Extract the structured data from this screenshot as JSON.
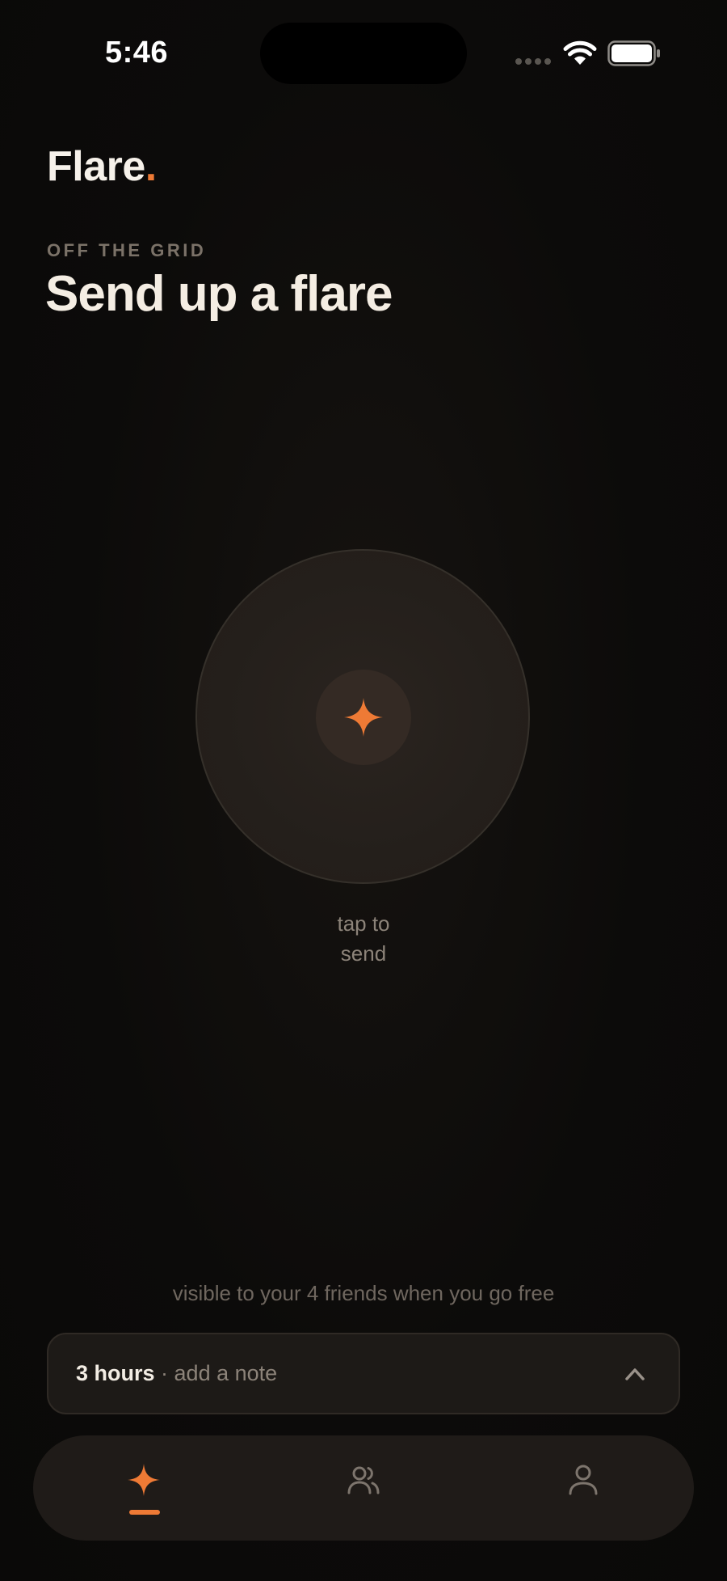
{
  "status_bar": {
    "time": "5:46"
  },
  "header": {
    "brand": "Flare",
    "brand_dot": ".",
    "eyebrow": "OFF THE GRID",
    "title": "Send up a flare"
  },
  "flare_button": {
    "icon": "sparkle-icon",
    "hint_line1": "tap to",
    "hint_line2": "send"
  },
  "visibility": {
    "text": "visible to your 4 friends when you go free"
  },
  "duration_bar": {
    "duration": "3 hours",
    "separator": " · ",
    "note_placeholder": "add a note",
    "icon": "chevron-up-icon"
  },
  "bottom_nav": {
    "items": [
      {
        "id": "flare",
        "icon": "sparkle-icon",
        "active": true
      },
      {
        "id": "friends",
        "icon": "users-icon",
        "active": false
      },
      {
        "id": "profile",
        "icon": "user-icon",
        "active": false
      }
    ]
  },
  "colors": {
    "accent": "#ee7a35",
    "background": "#0b0a09",
    "surface": "#1f1b18",
    "text_primary": "#f3ede4",
    "text_muted": "#8c8379"
  }
}
